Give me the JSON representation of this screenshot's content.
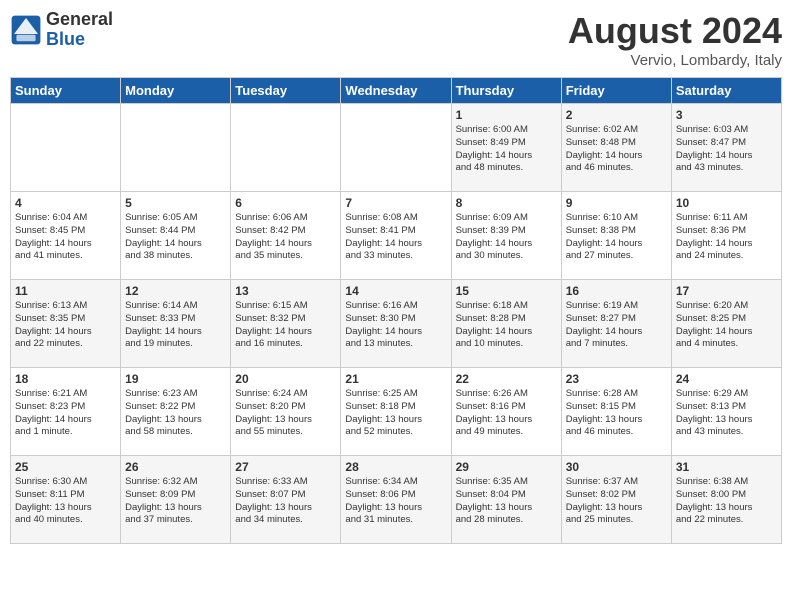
{
  "logo": {
    "line1": "General",
    "line2": "Blue"
  },
  "title": "August 2024",
  "location": "Vervio, Lombardy, Italy",
  "days_header": [
    "Sunday",
    "Monday",
    "Tuesday",
    "Wednesday",
    "Thursday",
    "Friday",
    "Saturday"
  ],
  "weeks": [
    [
      {
        "day": "",
        "info": ""
      },
      {
        "day": "",
        "info": ""
      },
      {
        "day": "",
        "info": ""
      },
      {
        "day": "",
        "info": ""
      },
      {
        "day": "1",
        "info": "Sunrise: 6:00 AM\nSunset: 8:49 PM\nDaylight: 14 hours\nand 48 minutes."
      },
      {
        "day": "2",
        "info": "Sunrise: 6:02 AM\nSunset: 8:48 PM\nDaylight: 14 hours\nand 46 minutes."
      },
      {
        "day": "3",
        "info": "Sunrise: 6:03 AM\nSunset: 8:47 PM\nDaylight: 14 hours\nand 43 minutes."
      }
    ],
    [
      {
        "day": "4",
        "info": "Sunrise: 6:04 AM\nSunset: 8:45 PM\nDaylight: 14 hours\nand 41 minutes."
      },
      {
        "day": "5",
        "info": "Sunrise: 6:05 AM\nSunset: 8:44 PM\nDaylight: 14 hours\nand 38 minutes."
      },
      {
        "day": "6",
        "info": "Sunrise: 6:06 AM\nSunset: 8:42 PM\nDaylight: 14 hours\nand 35 minutes."
      },
      {
        "day": "7",
        "info": "Sunrise: 6:08 AM\nSunset: 8:41 PM\nDaylight: 14 hours\nand 33 minutes."
      },
      {
        "day": "8",
        "info": "Sunrise: 6:09 AM\nSunset: 8:39 PM\nDaylight: 14 hours\nand 30 minutes."
      },
      {
        "day": "9",
        "info": "Sunrise: 6:10 AM\nSunset: 8:38 PM\nDaylight: 14 hours\nand 27 minutes."
      },
      {
        "day": "10",
        "info": "Sunrise: 6:11 AM\nSunset: 8:36 PM\nDaylight: 14 hours\nand 24 minutes."
      }
    ],
    [
      {
        "day": "11",
        "info": "Sunrise: 6:13 AM\nSunset: 8:35 PM\nDaylight: 14 hours\nand 22 minutes."
      },
      {
        "day": "12",
        "info": "Sunrise: 6:14 AM\nSunset: 8:33 PM\nDaylight: 14 hours\nand 19 minutes."
      },
      {
        "day": "13",
        "info": "Sunrise: 6:15 AM\nSunset: 8:32 PM\nDaylight: 14 hours\nand 16 minutes."
      },
      {
        "day": "14",
        "info": "Sunrise: 6:16 AM\nSunset: 8:30 PM\nDaylight: 14 hours\nand 13 minutes."
      },
      {
        "day": "15",
        "info": "Sunrise: 6:18 AM\nSunset: 8:28 PM\nDaylight: 14 hours\nand 10 minutes."
      },
      {
        "day": "16",
        "info": "Sunrise: 6:19 AM\nSunset: 8:27 PM\nDaylight: 14 hours\nand 7 minutes."
      },
      {
        "day": "17",
        "info": "Sunrise: 6:20 AM\nSunset: 8:25 PM\nDaylight: 14 hours\nand 4 minutes."
      }
    ],
    [
      {
        "day": "18",
        "info": "Sunrise: 6:21 AM\nSunset: 8:23 PM\nDaylight: 14 hours\nand 1 minute."
      },
      {
        "day": "19",
        "info": "Sunrise: 6:23 AM\nSunset: 8:22 PM\nDaylight: 13 hours\nand 58 minutes."
      },
      {
        "day": "20",
        "info": "Sunrise: 6:24 AM\nSunset: 8:20 PM\nDaylight: 13 hours\nand 55 minutes."
      },
      {
        "day": "21",
        "info": "Sunrise: 6:25 AM\nSunset: 8:18 PM\nDaylight: 13 hours\nand 52 minutes."
      },
      {
        "day": "22",
        "info": "Sunrise: 6:26 AM\nSunset: 8:16 PM\nDaylight: 13 hours\nand 49 minutes."
      },
      {
        "day": "23",
        "info": "Sunrise: 6:28 AM\nSunset: 8:15 PM\nDaylight: 13 hours\nand 46 minutes."
      },
      {
        "day": "24",
        "info": "Sunrise: 6:29 AM\nSunset: 8:13 PM\nDaylight: 13 hours\nand 43 minutes."
      }
    ],
    [
      {
        "day": "25",
        "info": "Sunrise: 6:30 AM\nSunset: 8:11 PM\nDaylight: 13 hours\nand 40 minutes."
      },
      {
        "day": "26",
        "info": "Sunrise: 6:32 AM\nSunset: 8:09 PM\nDaylight: 13 hours\nand 37 minutes."
      },
      {
        "day": "27",
        "info": "Sunrise: 6:33 AM\nSunset: 8:07 PM\nDaylight: 13 hours\nand 34 minutes."
      },
      {
        "day": "28",
        "info": "Sunrise: 6:34 AM\nSunset: 8:06 PM\nDaylight: 13 hours\nand 31 minutes."
      },
      {
        "day": "29",
        "info": "Sunrise: 6:35 AM\nSunset: 8:04 PM\nDaylight: 13 hours\nand 28 minutes."
      },
      {
        "day": "30",
        "info": "Sunrise: 6:37 AM\nSunset: 8:02 PM\nDaylight: 13 hours\nand 25 minutes."
      },
      {
        "day": "31",
        "info": "Sunrise: 6:38 AM\nSunset: 8:00 PM\nDaylight: 13 hours\nand 22 minutes."
      }
    ]
  ]
}
